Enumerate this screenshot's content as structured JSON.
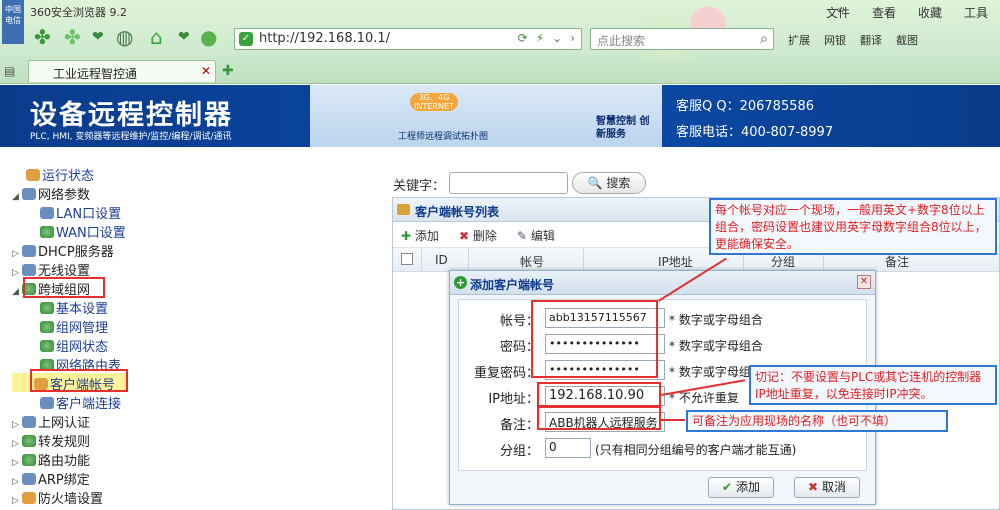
{
  "browser": {
    "title": "360安全浏览器 9.2",
    "badge": "中国电信",
    "menu": [
      "文件",
      "查看",
      "收藏",
      "工具"
    ],
    "chevron": "«",
    "url": "http://192.168.10.1/",
    "search_placeholder": "点此搜索",
    "extensions": [
      "扩展",
      "网银",
      "翻译",
      "截图"
    ],
    "tab_label": "工业远程智控通",
    "colors": {
      "accent": "#3aa23a",
      "banner": "#0b4aa8"
    }
  },
  "banner": {
    "title": "设备远程控制器",
    "subtitle": "PLC, HMI, 变频器等远程维护/监控/编程/调试/通讯",
    "network": "3G、4G INTERNET",
    "caption": "工程师远程调试拓扑图",
    "service": "智慧控制 创新服务",
    "qq": "客服Q Q：206785586",
    "tel": "客服电话：400-807-8997"
  },
  "sidebar": {
    "items": [
      {
        "label": "运行状态"
      },
      {
        "label": "网络参数"
      },
      {
        "label": "LAN口设置"
      },
      {
        "label": "WAN口设置"
      },
      {
        "label": "DHCP服务器"
      },
      {
        "label": "无线设置"
      },
      {
        "label": "跨域组网"
      },
      {
        "label": "基本设置"
      },
      {
        "label": "组网管理"
      },
      {
        "label": "组网状态"
      },
      {
        "label": "网络路由表"
      },
      {
        "label": "客户端帐号"
      },
      {
        "label": "客户端连接"
      },
      {
        "label": "上网认证"
      },
      {
        "label": "转发规则"
      },
      {
        "label": "路由功能"
      },
      {
        "label": "ARP绑定"
      },
      {
        "label": "防火墙设置"
      }
    ]
  },
  "main": {
    "keyword_label": "关键字：",
    "search_button": "搜索",
    "panel_title": "客户端帐号列表",
    "toolbar": {
      "add": "添加",
      "delete": "删除",
      "edit": "编辑"
    },
    "columns": [
      "ID",
      "帐号",
      "IP地址",
      "分组",
      "备注"
    ]
  },
  "dialog": {
    "title": "添加客户端帐号",
    "fields": {
      "account": {
        "label": "帐号：",
        "value": "abb13157115567",
        "hint": "* 数字或字母组合"
      },
      "password": {
        "label": "密码：",
        "value": "••••••••••••••",
        "hint": "* 数字或字母组合"
      },
      "repeat": {
        "label": "重复密码：",
        "value": "••••••••••••••",
        "hint": "* 数字或字母组合"
      },
      "ip": {
        "label": "IP地址：",
        "prefix": "192.168.10.",
        "value": "90",
        "hint": "* 不允许重复"
      },
      "note": {
        "label": "备注：",
        "value": "ABB机器人远程服务"
      },
      "group": {
        "label": "分组：",
        "value": "0",
        "hint": "(只有相同分组编号的客户端才能互通)"
      }
    },
    "ok": "添加",
    "cancel": "取消"
  },
  "annotations": {
    "note1": "每个帐号对应一个现场，一般用英文+数字8位以上组合，密码设置也建议用英字母数字组合8位以上，更能确保安全。",
    "note2": "切记：不要设置与PLC或其它连机的控制器IP地址重复，以免连接时IP冲突。",
    "note3": "可备注为应用现场的名称（也可不填）"
  }
}
